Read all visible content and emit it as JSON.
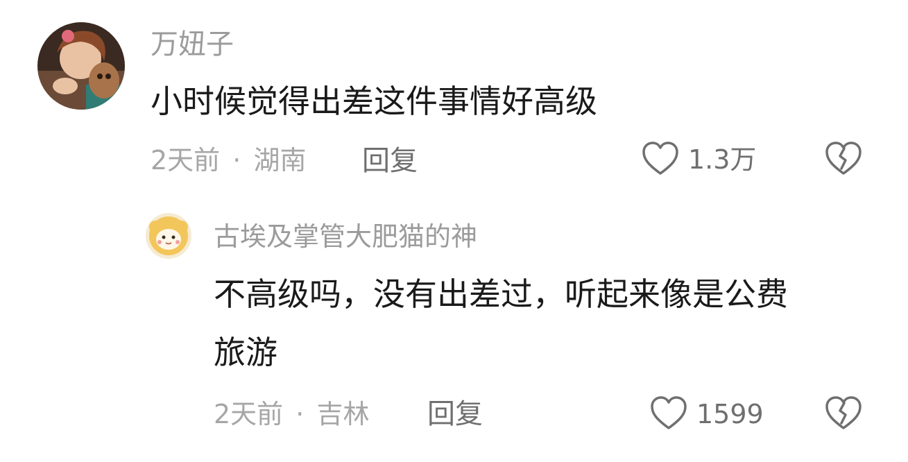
{
  "comments": [
    {
      "user": "万妞子",
      "text_lines": [
        "小时候觉得出差这件事情好高级"
      ],
      "time": "2天前",
      "separator": "·",
      "location": "湖南",
      "reply_label": "回复",
      "likes": "1.3万",
      "like_icon": "heart-outline-icon",
      "dislike_icon": "broken-heart-icon"
    },
    {
      "user": "古埃及掌管大肥猫的神",
      "text_lines": [
        "不高级吗，没有出差过，听起来像是公费",
        "旅游"
      ],
      "time": "2天前",
      "separator": "·",
      "location": "吉林",
      "reply_label": "回复",
      "likes": "1599",
      "like_icon": "heart-outline-icon",
      "dislike_icon": "broken-heart-icon"
    }
  ],
  "colors": {
    "username": "#9b9b9b",
    "content": "#1a1a1a",
    "meta": "#a6a6a6",
    "action": "#6f6f6f"
  }
}
